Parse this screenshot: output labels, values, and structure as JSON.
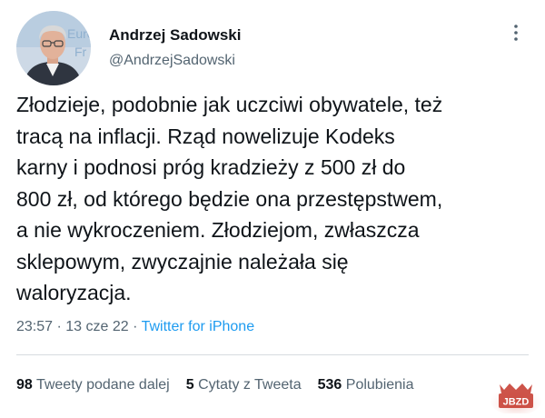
{
  "author": {
    "name": "Andrzej Sadowski",
    "handle": "@AndrzejSadowski",
    "avatar_icon": "profile-photo"
  },
  "tweet": {
    "lines": [
      "Złodzieje, podobnie jak uczciwi obywatele, też",
      "tracą na inflacji. Rząd nowelizuje Kodeks",
      "karny i podnosi próg kradzieży z 500 zł do",
      "800 zł, od którego będzie ona przestępstwem,",
      "a nie wykroczeniem. Złodziejom, zwłaszcza",
      "sklepowym, zwyczajnie należała się",
      "waloryzacja."
    ]
  },
  "meta": {
    "time": "23:57",
    "separator": " · ",
    "date": "13 cze 22",
    "source": "Twitter for iPhone"
  },
  "stats": {
    "retweets": {
      "count": "98",
      "label": "Tweety podane dalej"
    },
    "quotes": {
      "count": "5",
      "label": "Cytaty z Tweeta"
    },
    "likes": {
      "count": "536",
      "label": "Polubienia"
    }
  },
  "watermark": {
    "text": "JBZD"
  },
  "colors": {
    "text": "#0f1419",
    "secondary": "#536471",
    "link": "#1d9bf0",
    "divider": "#d6dbdf",
    "watermark_red": "#c4362a"
  }
}
